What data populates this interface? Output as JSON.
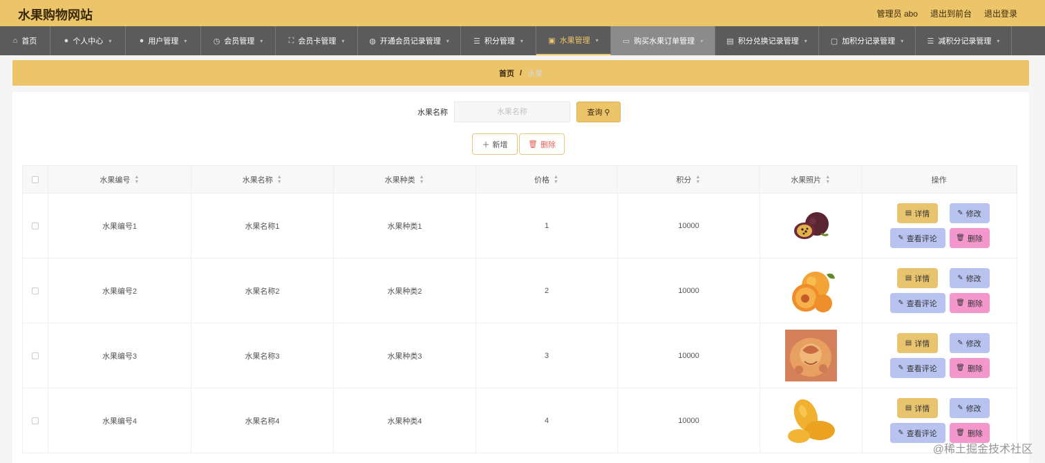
{
  "header": {
    "site_title": "水果购物网站",
    "admin_label": "管理员 abo",
    "exit_front": "退出到前台",
    "logout": "退出登录"
  },
  "nav": [
    {
      "label": "首页",
      "icon": "home-icon"
    },
    {
      "label": "个人中心",
      "icon": "user-icon"
    },
    {
      "label": "用户管理",
      "icon": "user-icon"
    },
    {
      "label": "会员管理",
      "icon": "clock-icon"
    },
    {
      "label": "会员卡管理",
      "icon": "card-icon"
    },
    {
      "label": "开通会员记录管理",
      "icon": "globe-icon"
    },
    {
      "label": "积分管理",
      "icon": "list-icon"
    },
    {
      "label": "水果管理",
      "icon": "checkbox-icon"
    },
    {
      "label": "购买水果订单管理",
      "icon": "cart-icon"
    },
    {
      "label": "积分兑换记录管理",
      "icon": "image-icon"
    },
    {
      "label": "加积分记录管理",
      "icon": "message-icon"
    },
    {
      "label": "减积分记录管理",
      "icon": "list-icon"
    }
  ],
  "breadcrumb": {
    "home": "首页",
    "separator": "/",
    "current": "水果"
  },
  "search": {
    "label": "水果名称",
    "placeholder": "水果名称",
    "value": "",
    "button": "查询"
  },
  "actions": {
    "add": "新增",
    "delete": "删除"
  },
  "table": {
    "headers": [
      "水果编号",
      "水果名称",
      "水果种类",
      "价格",
      "积分",
      "水果照片",
      "操作"
    ],
    "rows": [
      {
        "code": "水果编号1",
        "name": "水果名称1",
        "kind": "水果种类1",
        "price": "1",
        "points": "10000",
        "photo": "passion-fruit"
      },
      {
        "code": "水果编号2",
        "name": "水果名称2",
        "kind": "水果种类2",
        "price": "2",
        "points": "10000",
        "photo": "apricot"
      },
      {
        "code": "水果编号3",
        "name": "水果名称3",
        "kind": "水果种类3",
        "price": "3",
        "points": "10000",
        "photo": "carved-melon"
      },
      {
        "code": "水果编号4",
        "name": "水果名称4",
        "kind": "水果种类4",
        "price": "4",
        "points": "10000",
        "photo": "mango"
      }
    ],
    "row_actions": {
      "detail": "详情",
      "edit": "修改",
      "review": "查看评论",
      "delete": "删除"
    }
  },
  "watermark": "@稀土掘金技术社区",
  "colors": {
    "accent": "#ecc56a",
    "nav_bg": "#5b5b5b",
    "edit_btn": "#b8c3ef",
    "delete_btn": "#f497cd"
  }
}
